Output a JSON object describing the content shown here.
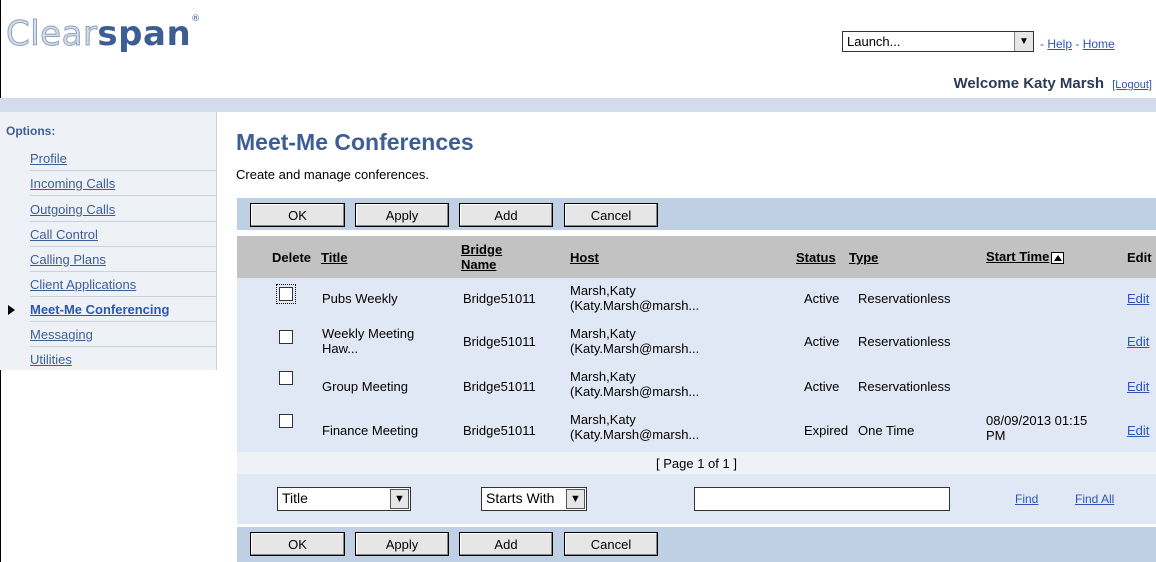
{
  "header": {
    "logo_light": "Clear",
    "logo_dark": "span",
    "logo_mark": "®",
    "launch_value": "Launch...",
    "help_link": "Help",
    "home_link": "Home",
    "link_sep": "-",
    "welcome": "Welcome Katy Marsh",
    "logout": "[Logout]"
  },
  "sidebar": {
    "title": "Options:",
    "items": [
      {
        "label": "Profile"
      },
      {
        "label": "Incoming Calls"
      },
      {
        "label": "Outgoing Calls"
      },
      {
        "label": "Call Control"
      },
      {
        "label": "Calling Plans"
      },
      {
        "label": "Client Applications"
      },
      {
        "label": "Meet-Me Conferencing"
      },
      {
        "label": "Messaging"
      },
      {
        "label": "Utilities"
      }
    ]
  },
  "main": {
    "title": "Meet-Me Conferences",
    "description": "Create and manage conferences.",
    "buttons": {
      "ok": "OK",
      "apply": "Apply",
      "add": "Add",
      "cancel": "Cancel"
    },
    "columns": {
      "delete": "Delete",
      "title": "Title",
      "bridge_line1": "Bridge",
      "bridge_line2": "Name",
      "host": "Host",
      "status": "Status",
      "type": "Type",
      "start_time": "Start Time",
      "edit": "Edit"
    },
    "rows": [
      {
        "title1": "Pubs Weekly",
        "title2": "",
        "bridge": "Bridge51011",
        "host1": "Marsh,Katy",
        "host2": "(Katy.Marsh@marsh...",
        "status": "Active",
        "type": "Reservationless",
        "start1": "",
        "start2": "",
        "edit": "Edit"
      },
      {
        "title1": "Weekly Meeting",
        "title2": "Haw...",
        "bridge": "Bridge51011",
        "host1": "Marsh,Katy",
        "host2": "(Katy.Marsh@marsh...",
        "status": "Active",
        "type": "Reservationless",
        "start1": "",
        "start2": "",
        "edit": "Edit"
      },
      {
        "title1": "Group Meeting",
        "title2": "",
        "bridge": "Bridge51011",
        "host1": "Marsh,Katy",
        "host2": "(Katy.Marsh@marsh...",
        "status": "Active",
        "type": "Reservationless",
        "start1": "",
        "start2": "",
        "edit": "Edit"
      },
      {
        "title1": "Finance Meeting",
        "title2": "",
        "bridge": "Bridge51011",
        "host1": "Marsh,Katy",
        "host2": "(Katy.Marsh@marsh...",
        "status": "Expired",
        "type": "One Time",
        "start1": "08/09/2013 01:15",
        "start2": "PM",
        "edit": "Edit"
      }
    ],
    "pagination": "[ Page 1 of 1 ]",
    "search": {
      "field_value": "Title",
      "mode_value": "Starts With",
      "input_value": "",
      "find": "Find",
      "find_all": "Find All"
    }
  }
}
